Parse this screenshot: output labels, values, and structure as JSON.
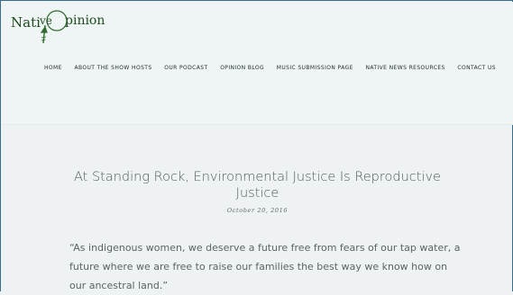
{
  "site": {
    "logo_text": "NativeOpinion",
    "colors": {
      "brand_green": "#2f6b2f",
      "text": "#505a5c",
      "border": "#3c6d86"
    }
  },
  "nav": {
    "items": [
      {
        "label": "HOME"
      },
      {
        "label": "ABOUT THE SHOW HOSTS"
      },
      {
        "label": "OUR PODCAST"
      },
      {
        "label": "OPINION BLOG"
      },
      {
        "label": "MUSIC SUBMISSION PAGE"
      },
      {
        "label": "NATIVE NEWS RESOURCES"
      },
      {
        "label": "CONTACT US"
      }
    ]
  },
  "post": {
    "title": "At Standing Rock, Environmental Justice Is Reproductive Justice",
    "date": "October 20, 2016",
    "excerpt": "“As indigenous women, we deserve a future free from fears of our tap water, a future where we are free to raise our families the best way we know how on our ancestral land.”"
  }
}
